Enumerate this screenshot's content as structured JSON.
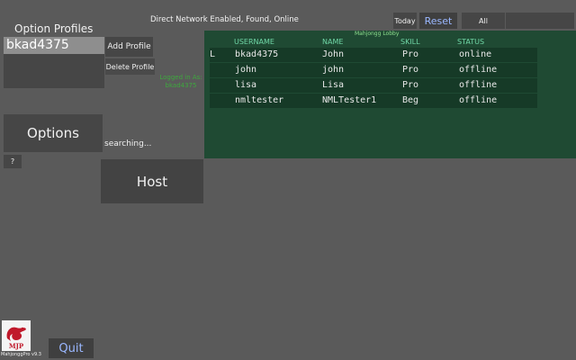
{
  "header": {
    "status_text": "Direct Network Enabled, Found, Online",
    "today_label": "Today",
    "reset_label": "Reset",
    "all_label": "All"
  },
  "profiles": {
    "title": "Option Profiles",
    "selected": "bkad4375",
    "add_label": "Add Profile",
    "delete_label": "Delete Profile",
    "logged_in_label": "Logged in As:",
    "logged_in_user": "bkad4375"
  },
  "controls": {
    "options_label": "Options",
    "help_label": "?",
    "searching_label": "searching...",
    "host_label": "Host",
    "quit_label": "Quit"
  },
  "lobby": {
    "title": "Mahjongg Lobby",
    "columns": [
      "USERNAME",
      "NAME",
      "SKILL",
      "STATUS"
    ],
    "rows": [
      {
        "marker": "L",
        "username": "bkad4375",
        "name": "John",
        "skill": "Pro",
        "status": "online"
      },
      {
        "marker": "",
        "username": "john",
        "name": "john",
        "skill": "Pro",
        "status": "offline"
      },
      {
        "marker": "",
        "username": "lisa",
        "name": "Lisa",
        "skill": "Pro",
        "status": "offline"
      },
      {
        "marker": "",
        "username": "nmltester",
        "name": "NMLTester1",
        "skill": "Beg",
        "status": "offline"
      }
    ]
  },
  "app": {
    "logo_text": "MJP",
    "version_label": "MahjonggPro v9.3"
  },
  "colors": {
    "background": "#5a5a5a",
    "panel": "#464646",
    "lobby_bg": "#1f4a33",
    "accent_text": "#9ab7ff",
    "logged_in_green": "#3ea83e"
  }
}
